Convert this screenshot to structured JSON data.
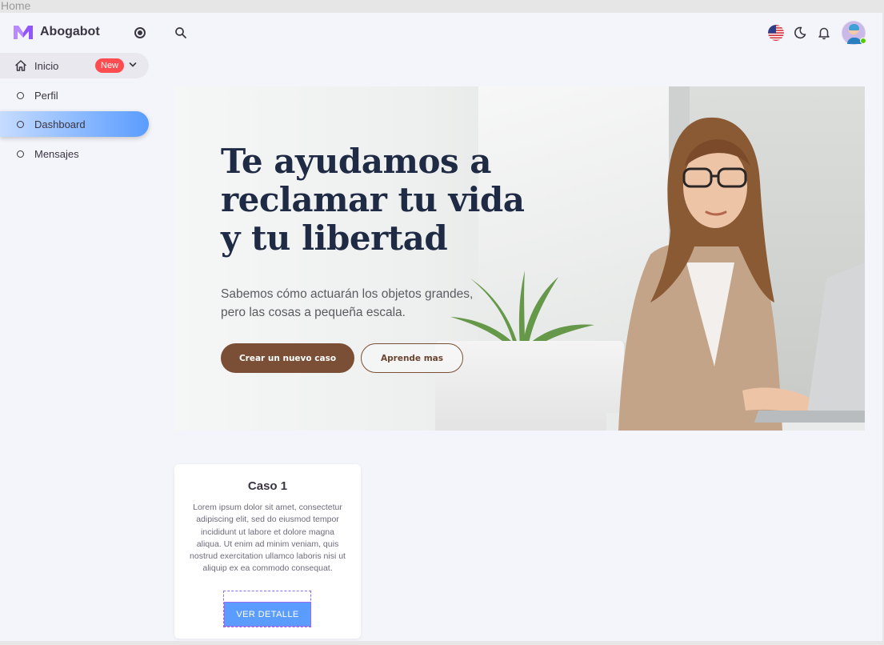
{
  "window": {
    "title": "Home"
  },
  "brand": {
    "name": "Abogabot",
    "logo_icon": "abogabot-m-logo",
    "logo_color": "#9155fd"
  },
  "sidebar": {
    "items": [
      {
        "label": "Inicio",
        "icon": "home-icon",
        "badge": "New",
        "expanded": true
      },
      {
        "label": "Perfil",
        "icon": "circle-icon"
      },
      {
        "label": "Dashboard",
        "icon": "circle-icon",
        "active": true
      },
      {
        "label": "Mensajes",
        "icon": "circle-icon"
      }
    ],
    "badge_color": "#ff4c51",
    "active_color": "#5a9cff"
  },
  "topbar": {
    "icons": [
      "search-icon",
      "us-flag-icon",
      "moon-icon",
      "bell-icon",
      "avatar"
    ],
    "status": "online"
  },
  "hero": {
    "title": "Te ayudamos a\nreclamar tu vida\ny tu libertad",
    "subtitle": " Sabemos cómo actuarán los objetos grandes,\npero las cosas a pequeña escala.",
    "primary_button": "Crear un nuevo caso",
    "secondary_button": "Aprende mas",
    "button_color": "#7a4f35"
  },
  "cases": [
    {
      "title": "Caso 1",
      "body": "Lorem ipsum dolor sit amet, consectetur adipiscing elit, sed do eiusmod tempor incididunt ut labore et dolore magna aliqua. Ut enim ad minim veniam, quis nostrud exercitation ullamco laboris nisi ut aliquip ex ea commodo consequat.",
      "button": "VER DETALLE"
    }
  ]
}
